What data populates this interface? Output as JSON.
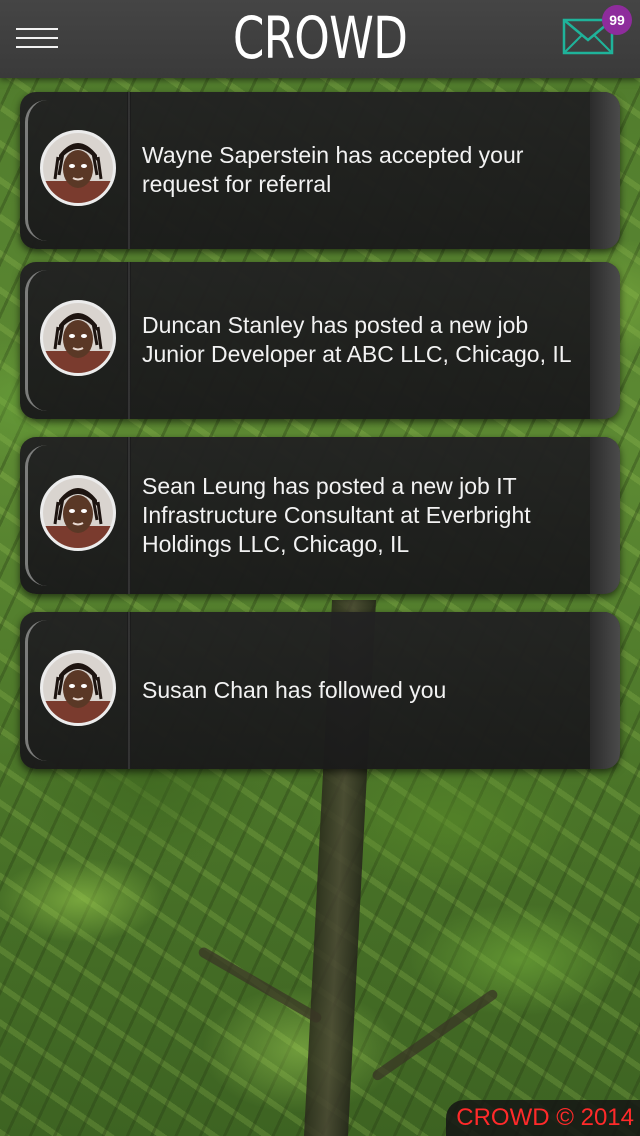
{
  "header": {
    "title": "CROWD",
    "unread_count": "99"
  },
  "notifications": [
    {
      "text": "Wayne Saperstein has accepted your request for referral"
    },
    {
      "text": "Duncan Stanley has posted a new job Junior Developer at ABC LLC, Chicago, IL"
    },
    {
      "text": "Sean Leung has posted a new job IT Infrastructure Consultant at Everbright Holdings LLC, Chicago, IL"
    },
    {
      "text": "Susan Chan has followed you"
    }
  ],
  "footer": {
    "copyright": "CROWD © 2014"
  },
  "colors": {
    "topbar": "#3f3f3f",
    "mail_icon": "#1fb39a",
    "badge": "#8e2c9c",
    "footer_text": "#ff2a2a"
  },
  "icons": {
    "menu": "hamburger-icon",
    "mail": "envelope-icon",
    "avatar": "user-photo"
  }
}
